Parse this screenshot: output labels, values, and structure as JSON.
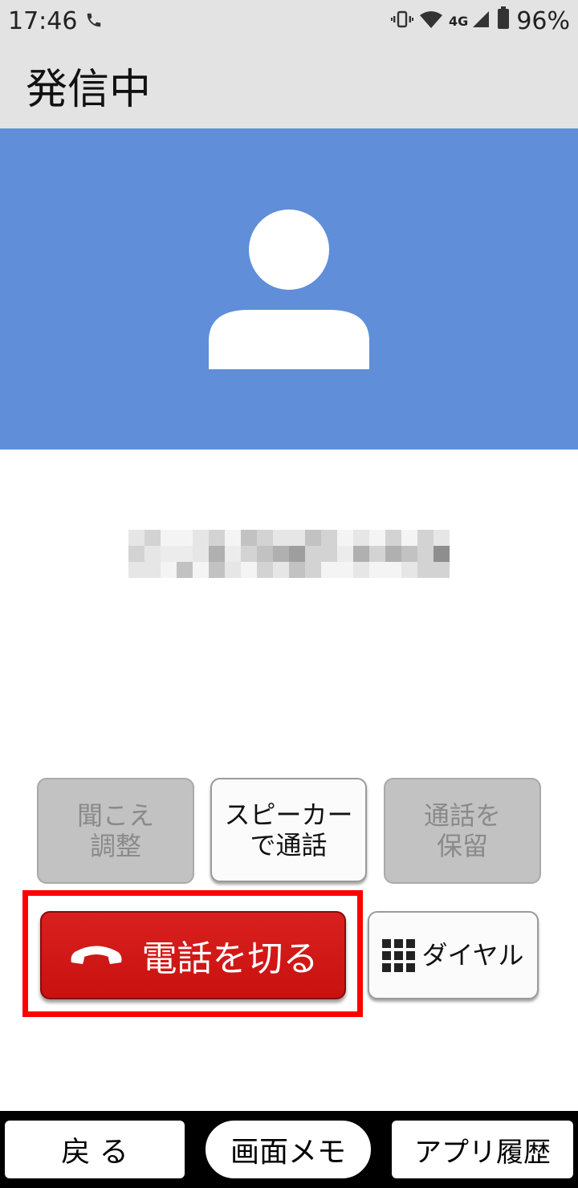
{
  "status_bar": {
    "time": "17:46",
    "network": "4G",
    "battery": "96%",
    "icons": [
      "phone-call-icon",
      "vibrate-icon",
      "wifi-icon",
      "cell-signal-icon",
      "battery-icon"
    ]
  },
  "app_bar": {
    "title": "発信中"
  },
  "contact": {
    "number": "",
    "avatar": "person-avatar-icon"
  },
  "controls": {
    "volume_label": "聞こえ\n調整",
    "speaker_label": "スピーカー\nで通話",
    "hold_label": "通話を\n保留",
    "hangup_label": "電話を切る",
    "dial_label": "ダイヤル"
  },
  "nav": {
    "back_label": "戻 る",
    "memo_label": "画面メモ",
    "history_label": "アプリ履歴"
  },
  "colors": {
    "banner": "#608ed8",
    "hangup": "#d01817",
    "highlight": "#ff0000",
    "bar": "#e3e3e3"
  }
}
